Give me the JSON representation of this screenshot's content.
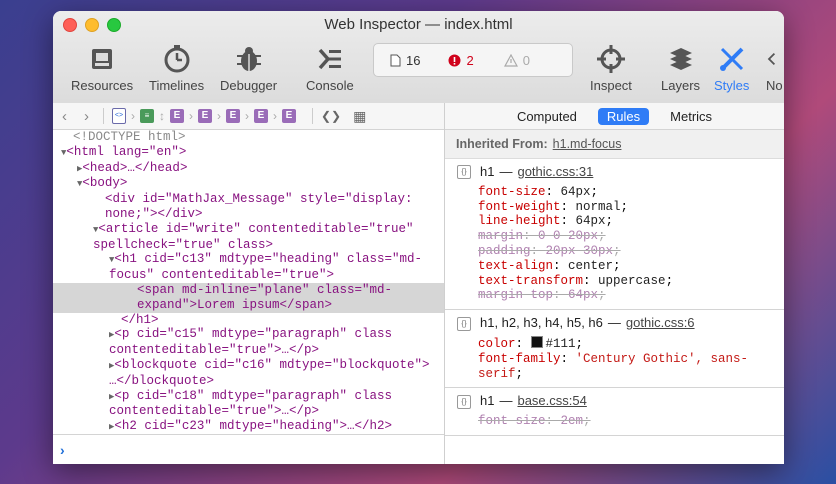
{
  "window": {
    "title": "Web Inspector — index.html"
  },
  "toolbar": {
    "items": [
      {
        "label": "Resources",
        "icon": "resources-icon"
      },
      {
        "label": "Timelines",
        "icon": "timelines-icon"
      },
      {
        "label": "Debugger",
        "icon": "debugger-icon"
      },
      {
        "label": "Console",
        "icon": "console-icon"
      },
      {
        "label": "Inspect",
        "icon": "crosshair-icon"
      },
      {
        "label": "Layers",
        "icon": "layers-icon"
      },
      {
        "label": "Styles",
        "icon": "styles-icon"
      },
      {
        "label": "No",
        "icon": "chevron-left-icon"
      }
    ],
    "dashboard": {
      "resources_count": "16",
      "errors_count": "2",
      "warnings_count": "0"
    }
  },
  "dom": {
    "lines": [
      "<!DOCTYPE html>",
      "<html lang=\"en\">",
      "<head>…</head>",
      "<body>",
      "<div id=\"MathJax_Message\" style=\"display:",
      "none;\"></div>",
      "<article id=\"write\" contenteditable=\"true\"",
      "spellcheck=\"true\" class>",
      "<h1 cid=\"c13\" mdtype=\"heading\" class=\"md-",
      "focus\" contenteditable=\"true\">",
      "<span md-inline=\"plane\" class=\"md-",
      "expand\">Lorem ipsum</span>",
      "</h1>",
      "<p cid=\"c15\" mdtype=\"paragraph\" class",
      "contenteditable=\"true\">…</p>",
      "<blockquote cid=\"c16\" mdtype=\"blockquote\">",
      "…</blockquote>",
      "<p cid=\"c18\" mdtype=\"paragraph\" class",
      "contenteditable=\"true\">…</p>",
      "<h2 cid=\"c23\" mdtype=\"heading\">…</h2>"
    ]
  },
  "sidebar": {
    "tabs": [
      "Computed",
      "Rules",
      "Metrics"
    ],
    "active_tab": "Rules",
    "inherited_label": "Inherited From:",
    "inherited_from": "h1.md-focus",
    "rules": [
      {
        "selector": "h1",
        "separator": "—",
        "source": "gothic.css:31",
        "declarations": [
          {
            "prop": "font-size",
            "value": "64px",
            "overridden": false
          },
          {
            "prop": "font-weight",
            "value": "normal",
            "overridden": false
          },
          {
            "prop": "line-height",
            "value": "64px",
            "overridden": false
          },
          {
            "prop": "margin",
            "value": "0 0 20px",
            "overridden": true
          },
          {
            "prop": "padding",
            "value": "20px 30px",
            "overridden": true
          },
          {
            "prop": "text-align",
            "value": "center",
            "overridden": false
          },
          {
            "prop": "text-transform",
            "value": "uppercase",
            "overridden": false
          },
          {
            "prop": "margin-top",
            "value": "64px",
            "overridden": true
          }
        ]
      },
      {
        "selector": "h1, h2, h3, h4, h5, h6",
        "separator": "—",
        "source": "gothic.css:6",
        "declarations": [
          {
            "prop": "color",
            "value": "#111",
            "overridden": false
          },
          {
            "prop": "font-family",
            "value": "'Century Gothic', sans-",
            "overridden": false
          },
          {
            "prop": "",
            "value": "serif",
            "overridden": false
          }
        ]
      },
      {
        "selector": "h1",
        "separator": "—",
        "source": "base.css:54",
        "declarations": [
          {
            "prop": "font-size",
            "value": "2em",
            "overridden": true
          }
        ]
      }
    ]
  },
  "colors": {
    "accent": "#2f7cf6",
    "error": "#d0021b",
    "tag": "#881280",
    "attr": "#994500",
    "value": "#1a1aa6"
  }
}
